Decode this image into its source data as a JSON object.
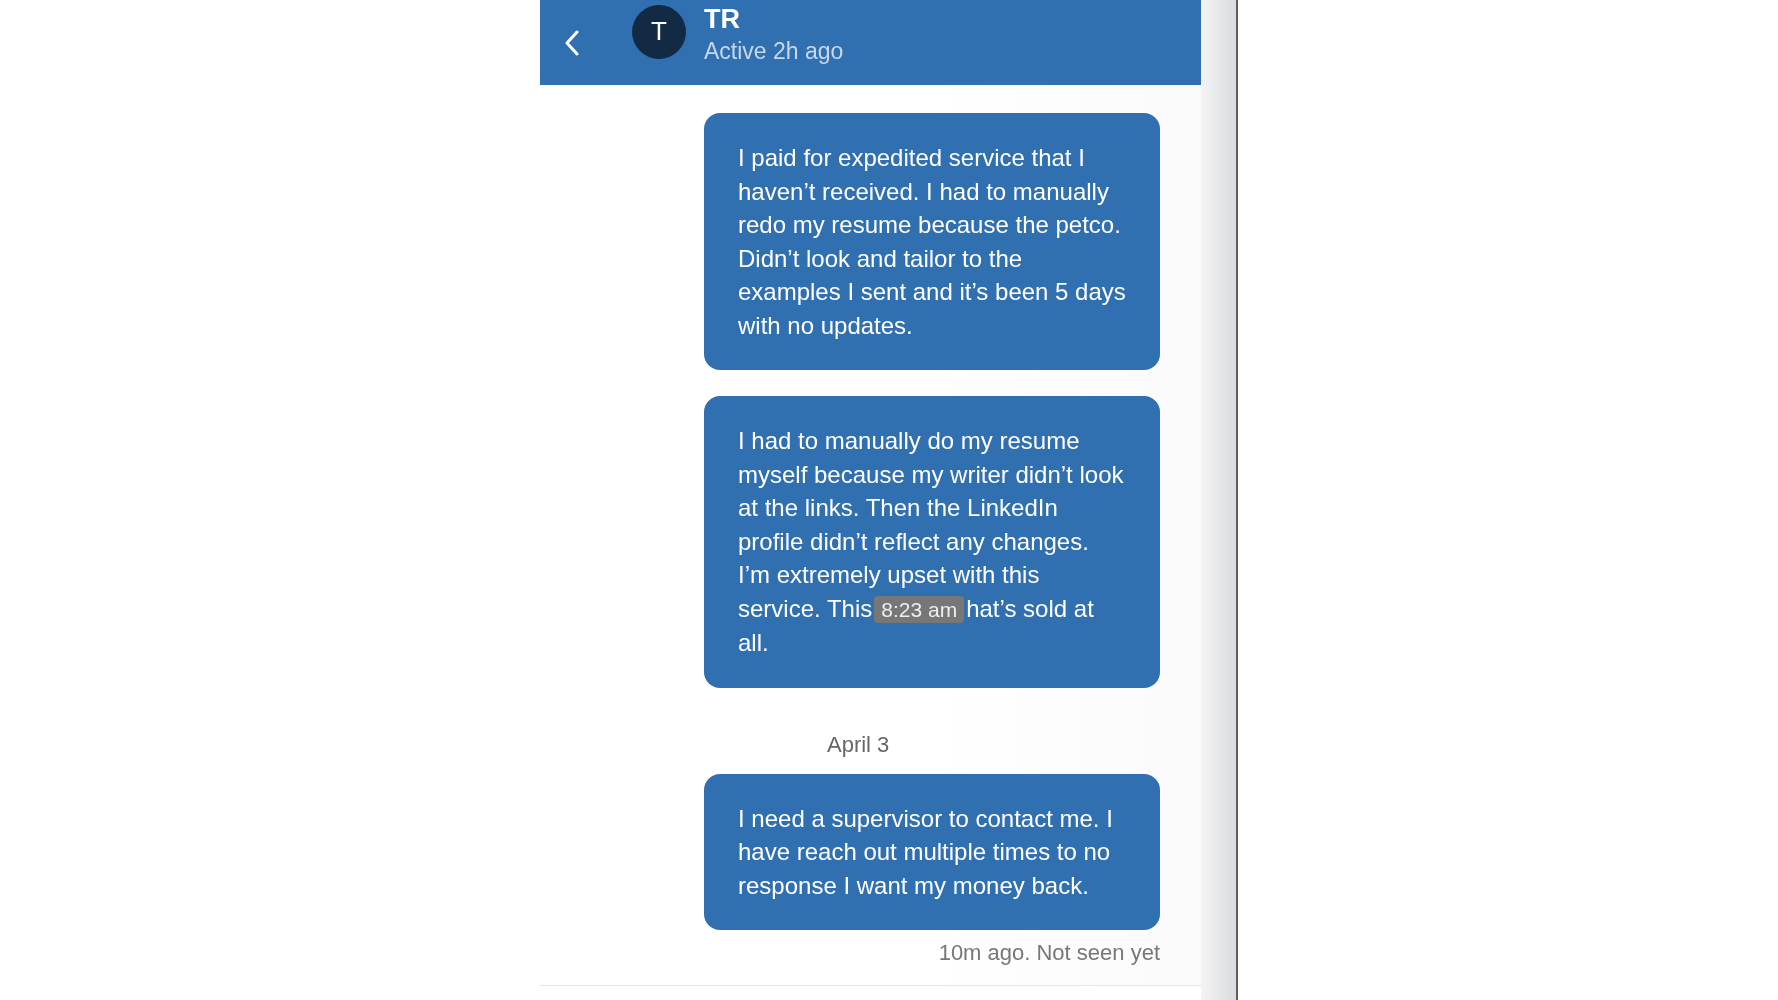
{
  "header": {
    "avatar_letter": "T",
    "name": "TR",
    "status": "Active 2h ago"
  },
  "items": [
    {
      "kind": "message",
      "text": "I paid for expedited service that I haven’t received. I had to manually redo my resume because the petco. Didn’t look and tailor to the examples I sent and it’s been 5 days with no updates."
    },
    {
      "kind": "message",
      "text": "I had to manually do my resume myself because my writer didn’t look at the links. Then the LinkedIn profile didn’t reflect any changes. I’m extremely upset with this service. This",
      "tooltip": "8:23 am",
      "text_after": "hat’s sold at all."
    },
    {
      "kind": "date",
      "text": "April 3"
    },
    {
      "kind": "message",
      "text": "I need a supervisor to contact me. I have reach out multiple times to no response I want my money back."
    }
  ],
  "footer_status": "10m ago. Not seen yet"
}
